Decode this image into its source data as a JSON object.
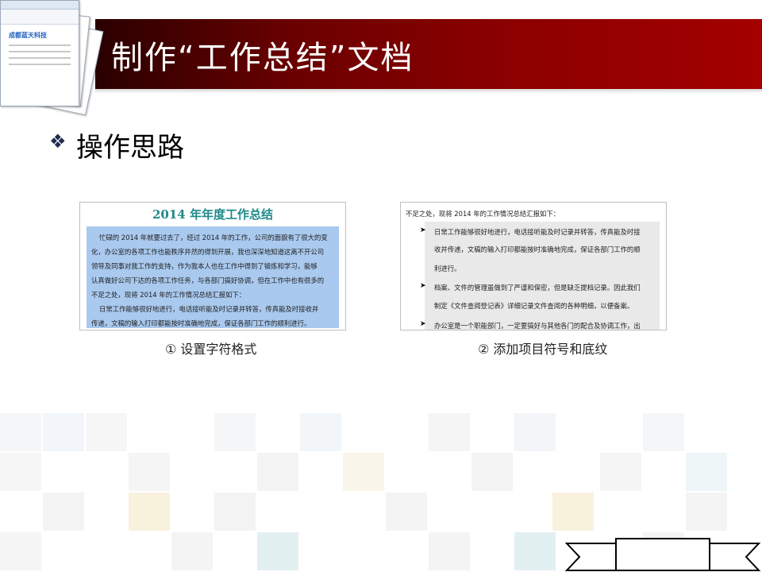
{
  "slide": {
    "title": "制作“工作总结”文档",
    "heading_bullet": "❖",
    "heading": "操作思路"
  },
  "panel1": {
    "doc_title": "2014 年年度工作总结",
    "lines": [
      "忙碌的 2014 年就要过去了，经过 2014 年的工作，公司的面貌有了很大的变",
      "化，办公室的各项工作也能秩序井然的得到开展，我也深深地知道这离不开公司",
      "领导及同事对我工作的支持，作为我本人也在工作中得到了锻炼和学习，能够",
      "认真做好公司下达的各项工作任务，与各部门搞好协调，但在工作中也有很多的",
      "不足之处，现将 2014 年的工作情况总结汇报如下：",
      "日常工作能够很好地进行，电话接听能及时记录并转答，传真能及时接收并",
      "传递，文稿的输入打印都能按时准确地完成，保证各部门工作的顺利进行。"
    ],
    "caption": "① 设置字符格式"
  },
  "panel2": {
    "intro": "不足之处，现将 2014 年的工作情况总结汇报如下：",
    "lines": [
      "日常工作能够很好地进行，电话接听能及时记录并转答，传真能及时接",
      "收并传递，文稿的输入打印都能按时准确地完成，保证各部门工作的顺",
      "利进行。",
      "档案、文件的管理虽做到了严谨和保密，但是缺乏提档记录。因此我们",
      "制定《文件查阅登记表》详细记录文件查阅的各种明细，以便备案。",
      "办公室是一个职能部门，一定要搞好与其他各门的配合及协调工作，出"
    ],
    "arrow": "➤",
    "caption": "② 添加项目符号和底纹"
  },
  "thumbnail": {
    "heading": "成都蓝天科技"
  },
  "colors": {
    "header_dark": "#2a0000",
    "header_light": "#a40000",
    "highlight": "#a9c9ef",
    "shading": "#e9e9e9",
    "doc_title": "#1f8a8a"
  }
}
